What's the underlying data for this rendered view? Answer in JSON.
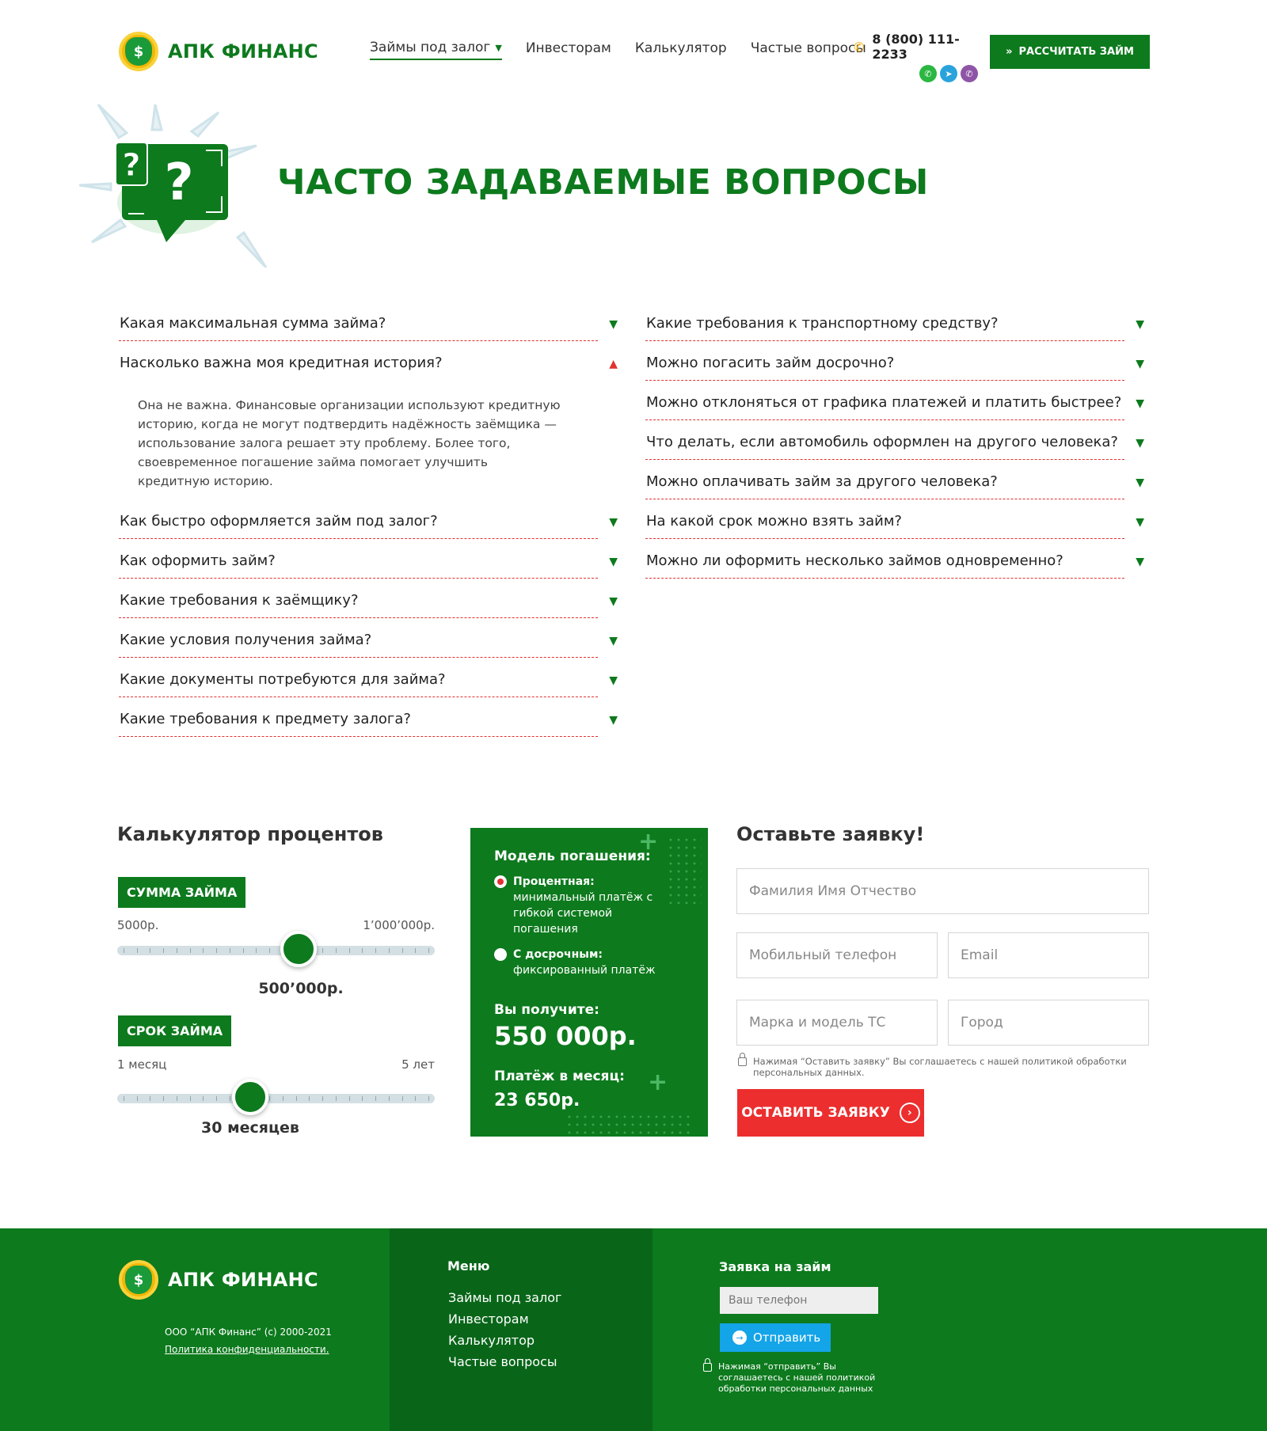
{
  "brand": {
    "name": "АПК ФИНАНС",
    "logo_symbol": "$"
  },
  "nav": {
    "items": [
      {
        "label": "Займы под залог",
        "active": true,
        "has_dropdown": true
      },
      {
        "label": "Инвесторам"
      },
      {
        "label": "Калькулятор"
      },
      {
        "label": "Частые вопросы"
      }
    ]
  },
  "header": {
    "phone": "8 (800) 111-2233",
    "messengers": [
      "whatsapp-icon",
      "telegram-icon",
      "viber-icon"
    ],
    "cta_label": "РАССЧИТАТЬ ЗАЙМ"
  },
  "hero": {
    "title": "ЧАСТО ЗАДАВАЕМЫЕ ВОПРОСЫ"
  },
  "faq": {
    "left": [
      {
        "q": "Какая максимальная сумма займа?",
        "open": false
      },
      {
        "q": "Насколько важна моя кредитная история?",
        "open": true,
        "a": "Она не важна. Финансовые организации используют кредитную историю, когда не могут подтвердить надёжность заёмщика — использование залога решает эту проблему. Более того, своевременное погашение займа помогает улучшить кредитную историю."
      },
      {
        "q": "Как быстро оформляется займ под залог?",
        "open": false
      },
      {
        "q": "Как оформить займ?",
        "open": false
      },
      {
        "q": "Какие требования к заёмщику?",
        "open": false
      },
      {
        "q": "Какие условия получения займа?",
        "open": false
      },
      {
        "q": "Какие документы потребуются для займа?",
        "open": false
      },
      {
        "q": "Какие требования к предмету залога?",
        "open": false
      }
    ],
    "right": [
      {
        "q": "Какие требования к транспортному средству?",
        "open": false
      },
      {
        "q": "Можно погасить займ досрочно?",
        "open": false
      },
      {
        "q": "Можно отклоняться от графика платежей и платить быстрее?",
        "open": false
      },
      {
        "q": "Что делать, если автомобиль оформлен на другого человека?",
        "open": false
      },
      {
        "q": "Можно оплачивать займ за другого человека?",
        "open": false
      },
      {
        "q": "На какой срок можно взять займ?",
        "open": false
      },
      {
        "q": "Можно ли оформить несколько займов одновременно?",
        "open": false
      }
    ]
  },
  "calculator": {
    "title": "Калькулятор процентов",
    "amount": {
      "label": "СУММА ЗАЙМА",
      "min_label": "5000р.",
      "max_label": "1’000’000р.",
      "value_label": "500’000р.",
      "position": 0.57
    },
    "term": {
      "label": "СРОК ЗАЙМА",
      "min_label": "1 месяц",
      "max_label": "5 лет",
      "value_label": "30 месяцев",
      "position": 0.42
    }
  },
  "result_card": {
    "model_title": "Модель погашения:",
    "options": [
      {
        "bold": "Процентная:",
        "text": " минимальный платёж с гибкой системой погашения",
        "selected": true
      },
      {
        "bold": "С досрочным:",
        "text": " фиксированный платёж",
        "selected": false
      }
    ],
    "receive_label": "Вы получите:",
    "receive_value": "550 000р.",
    "payment_label": "Платёж в месяц:",
    "payment_value": "23 650р."
  },
  "form": {
    "title": "Оставьте заявку!",
    "fio_placeholder": "Фамилия Имя Отчество",
    "phone_placeholder": "Мобильный телефон",
    "email_placeholder": "Email",
    "car_placeholder": "Марка и модель ТС",
    "city_placeholder": "Город",
    "policy": "Нажимая “Оставить заявку” Вы соглашаетесь с нашей политикой обработки персональных данных.",
    "submit_label": "ОСТАВИТЬ ЗАЯВКУ"
  },
  "footer": {
    "copyright": "ООО “АПК Финанс”  (с) 2000-2021",
    "privacy_link": "Политика конфиденциальности.",
    "menu_title": "Меню",
    "menu": [
      "Займы под залог",
      "Инвесторам",
      "Калькулятор",
      "Частые вопросы"
    ],
    "application_title": "Заявка на займ",
    "phone_placeholder": "Ваш телефон",
    "send_label": "Отправить",
    "policy": "Нажимая “отправить” Вы соглашаетесь с нашей политикой обработки персональных данных"
  },
  "colors": {
    "brand_green": "#0d7a1d",
    "accent_red": "#ec2e2e",
    "send_blue": "#14a4e8",
    "coin_yellow": "#f2b705"
  }
}
